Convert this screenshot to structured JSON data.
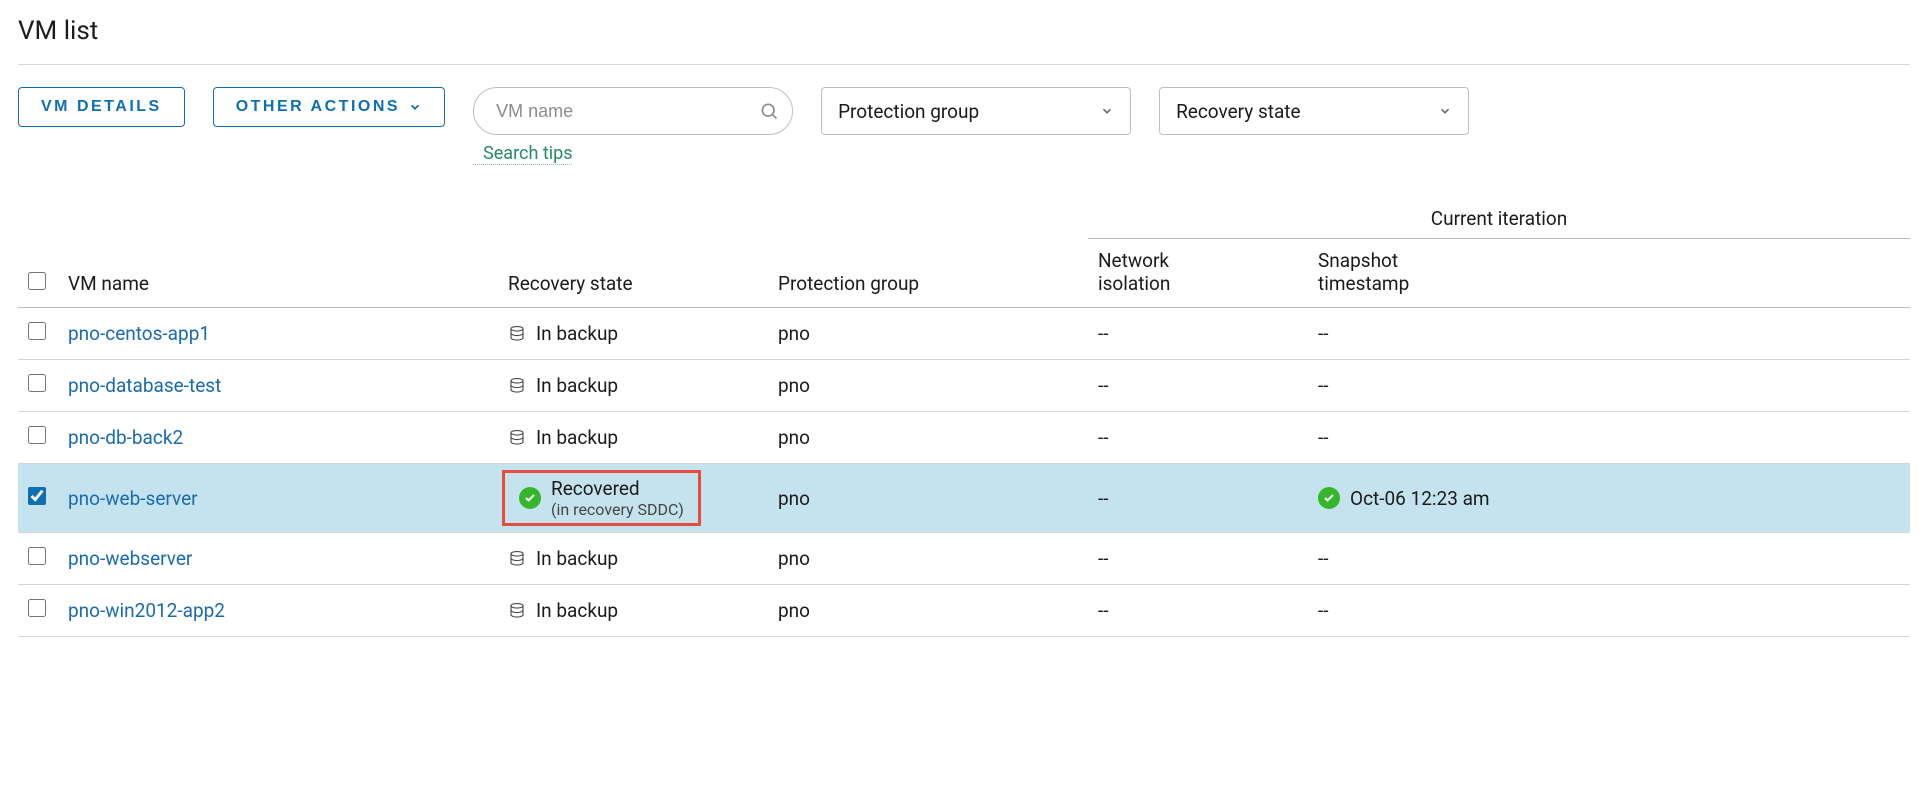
{
  "page_title": "VM list",
  "toolbar": {
    "details_label": "VM DETAILS",
    "actions_label": "OTHER ACTIONS",
    "search_placeholder": "VM name",
    "search_tips": "Search tips"
  },
  "filters": {
    "protection_group": "Protection group",
    "recovery_state": "Recovery state"
  },
  "headers": {
    "vm_name": "VM name",
    "recovery_state": "Recovery state",
    "protection_group": "Protection group",
    "current_iteration": "Current iteration",
    "network_isolation": "Network isolation",
    "snapshot_timestamp": "Snapshot timestamp"
  },
  "rows": [
    {
      "name": "pno-centos-app1",
      "state": "In backup",
      "state_kind": "backup",
      "sub": "",
      "group": "pno",
      "net": "--",
      "snap": "--",
      "checked": false
    },
    {
      "name": "pno-database-test",
      "state": "In backup",
      "state_kind": "backup",
      "sub": "",
      "group": "pno",
      "net": "--",
      "snap": "--",
      "checked": false
    },
    {
      "name": "pno-db-back2",
      "state": "In backup",
      "state_kind": "backup",
      "sub": "",
      "group": "pno",
      "net": "--",
      "snap": "--",
      "checked": false
    },
    {
      "name": "pno-web-server",
      "state": "Recovered",
      "state_kind": "recovered",
      "sub": "(in recovery SDDC)",
      "group": "pno",
      "net": "--",
      "snap": "Oct-06 12:23 am",
      "checked": true
    },
    {
      "name": "pno-webserver",
      "state": "In backup",
      "state_kind": "backup",
      "sub": "",
      "group": "pno",
      "net": "--",
      "snap": "--",
      "checked": false
    },
    {
      "name": "pno-win2012-app2",
      "state": "In backup",
      "state_kind": "backup",
      "sub": "",
      "group": "pno",
      "net": "--",
      "snap": "--",
      "checked": false
    }
  ]
}
